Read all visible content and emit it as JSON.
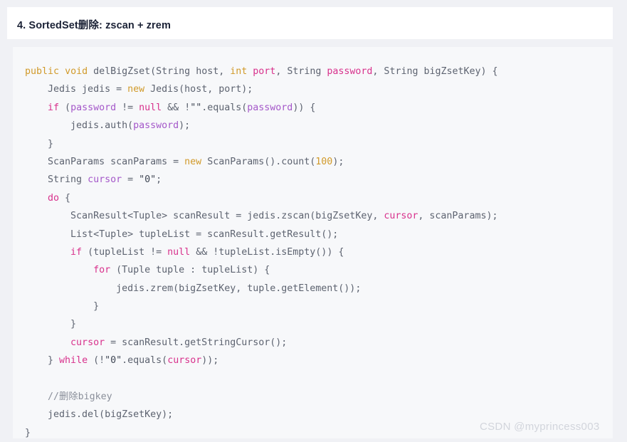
{
  "header": {
    "title": "4. SortedSet删除: zscan + zrem"
  },
  "watermark": {
    "text": "CSDN @myprincess003"
  },
  "colors": {
    "page_background": "#f0f1f5",
    "header_background": "#ffffff",
    "code_background": "#f7f8fa",
    "header_text": "#1b2236",
    "code_default_text": "#5d6370",
    "keyword_pink": "#d8318c",
    "keyword_gold": "#d19a2a",
    "identifier_purple": "#a457c9",
    "comment_gray": "#8a8f9a",
    "watermark_gray": "#d2d5dc"
  },
  "code": {
    "language": "java",
    "plain_text": "public void delBigZset(String host, int port, String password, String bigZsetKey) {\n    Jedis jedis = new Jedis(host, port);\n    if (password != null && !\"\".equals(password)) {\n        jedis.auth(password);\n    }\n    ScanParams scanParams = new ScanParams().count(100);\n    String cursor = \"0\";\n    do {\n        ScanResult<Tuple> scanResult = jedis.zscan(bigZsetKey, cursor, scanParams);\n        List<Tuple> tupleList = scanResult.getResult();\n        if (tupleList != null && !tupleList.isEmpty()) {\n            for (Tuple tuple : tupleList) {\n                jedis.zrem(bigZsetKey, tuple.getElement());\n            }\n        }\n        cursor = scanResult.getStringCursor();\n    } while (!\"0\".equals(cursor));\n\n    //删除bigkey\n    jedis.del(bigZsetKey);\n}",
    "lines": [
      {
        "n": 1,
        "tokens": [
          {
            "t": "public",
            "c": "kw2"
          },
          {
            "t": " ",
            "c": "plain"
          },
          {
            "t": "void",
            "c": "kw2"
          },
          {
            "t": " delBigZset(String host, ",
            "c": "plain"
          },
          {
            "t": "int",
            "c": "kw2"
          },
          {
            "t": " ",
            "c": "plain"
          },
          {
            "t": "port",
            "c": "kw"
          },
          {
            "t": ", String ",
            "c": "plain"
          },
          {
            "t": "password",
            "c": "kw"
          },
          {
            "t": ", String bigZsetKey) {",
            "c": "plain"
          }
        ]
      },
      {
        "n": 2,
        "tokens": [
          {
            "t": "    Jedis jedis = ",
            "c": "plain"
          },
          {
            "t": "new",
            "c": "kw2"
          },
          {
            "t": " Jedis(host, port);",
            "c": "plain"
          }
        ]
      },
      {
        "n": 3,
        "tokens": [
          {
            "t": "    ",
            "c": "plain"
          },
          {
            "t": "if",
            "c": "kw"
          },
          {
            "t": " (",
            "c": "plain"
          },
          {
            "t": "password",
            "c": "param"
          },
          {
            "t": " != ",
            "c": "plain"
          },
          {
            "t": "null",
            "c": "kw"
          },
          {
            "t": " && !",
            "c": "plain"
          },
          {
            "t": "\"\"",
            "c": "str"
          },
          {
            "t": ".equals(",
            "c": "plain"
          },
          {
            "t": "password",
            "c": "param"
          },
          {
            "t": ")) {",
            "c": "plain"
          }
        ]
      },
      {
        "n": 4,
        "tokens": [
          {
            "t": "        jedis.auth(",
            "c": "plain"
          },
          {
            "t": "password",
            "c": "param"
          },
          {
            "t": ");",
            "c": "plain"
          }
        ]
      },
      {
        "n": 5,
        "tokens": [
          {
            "t": "    }",
            "c": "plain"
          }
        ]
      },
      {
        "n": 6,
        "tokens": [
          {
            "t": "    ScanParams scanParams = ",
            "c": "plain"
          },
          {
            "t": "new",
            "c": "kw2"
          },
          {
            "t": " ScanParams().count(",
            "c": "plain"
          },
          {
            "t": "100",
            "c": "kw2"
          },
          {
            "t": ");",
            "c": "plain"
          }
        ]
      },
      {
        "n": 7,
        "tokens": [
          {
            "t": "    String ",
            "c": "plain"
          },
          {
            "t": "cursor",
            "c": "param"
          },
          {
            "t": " = ",
            "c": "plain"
          },
          {
            "t": "\"0\"",
            "c": "str"
          },
          {
            "t": ";",
            "c": "plain"
          }
        ]
      },
      {
        "n": 8,
        "tokens": [
          {
            "t": "    ",
            "c": "plain"
          },
          {
            "t": "do",
            "c": "kw"
          },
          {
            "t": " {",
            "c": "plain"
          }
        ]
      },
      {
        "n": 9,
        "tokens": [
          {
            "t": "        ScanResult<Tuple> scanResult = jedis.zscan(bigZsetKey, ",
            "c": "plain"
          },
          {
            "t": "cursor",
            "c": "kw"
          },
          {
            "t": ", scanParams);",
            "c": "plain"
          }
        ]
      },
      {
        "n": 10,
        "tokens": [
          {
            "t": "        List<Tuple> tupleList = scanResult.getResult();",
            "c": "plain"
          }
        ]
      },
      {
        "n": 11,
        "tokens": [
          {
            "t": "        ",
            "c": "plain"
          },
          {
            "t": "if",
            "c": "kw"
          },
          {
            "t": " (tupleList != ",
            "c": "plain"
          },
          {
            "t": "null",
            "c": "kw"
          },
          {
            "t": " && !tupleList.isEmpty()) {",
            "c": "plain"
          }
        ]
      },
      {
        "n": 12,
        "tokens": [
          {
            "t": "            ",
            "c": "plain"
          },
          {
            "t": "for",
            "c": "kw"
          },
          {
            "t": " (Tuple tuple : tupleList) {",
            "c": "plain"
          }
        ]
      },
      {
        "n": 13,
        "tokens": [
          {
            "t": "                jedis.zrem(bigZsetKey, tuple.getElement());",
            "c": "plain"
          }
        ]
      },
      {
        "n": 14,
        "tokens": [
          {
            "t": "            }",
            "c": "plain"
          }
        ]
      },
      {
        "n": 15,
        "tokens": [
          {
            "t": "        }",
            "c": "plain"
          }
        ]
      },
      {
        "n": 16,
        "tokens": [
          {
            "t": "        ",
            "c": "plain"
          },
          {
            "t": "cursor",
            "c": "kw"
          },
          {
            "t": " = scanResult.getStringCursor();",
            "c": "plain"
          }
        ]
      },
      {
        "n": 17,
        "tokens": [
          {
            "t": "    } ",
            "c": "plain"
          },
          {
            "t": "while",
            "c": "kw"
          },
          {
            "t": " (!",
            "c": "plain"
          },
          {
            "t": "\"0\"",
            "c": "str"
          },
          {
            "t": ".equals(",
            "c": "plain"
          },
          {
            "t": "cursor",
            "c": "kw"
          },
          {
            "t": "));",
            "c": "plain"
          }
        ]
      },
      {
        "n": 18,
        "tokens": [
          {
            "t": "",
            "c": "plain"
          }
        ]
      },
      {
        "n": 19,
        "tokens": [
          {
            "t": "    //删除bigkey",
            "c": "cmt"
          }
        ]
      },
      {
        "n": 20,
        "tokens": [
          {
            "t": "    jedis.del(bigZsetKey);",
            "c": "plain"
          }
        ]
      },
      {
        "n": 21,
        "tokens": [
          {
            "t": "}",
            "c": "plain"
          }
        ]
      }
    ]
  }
}
